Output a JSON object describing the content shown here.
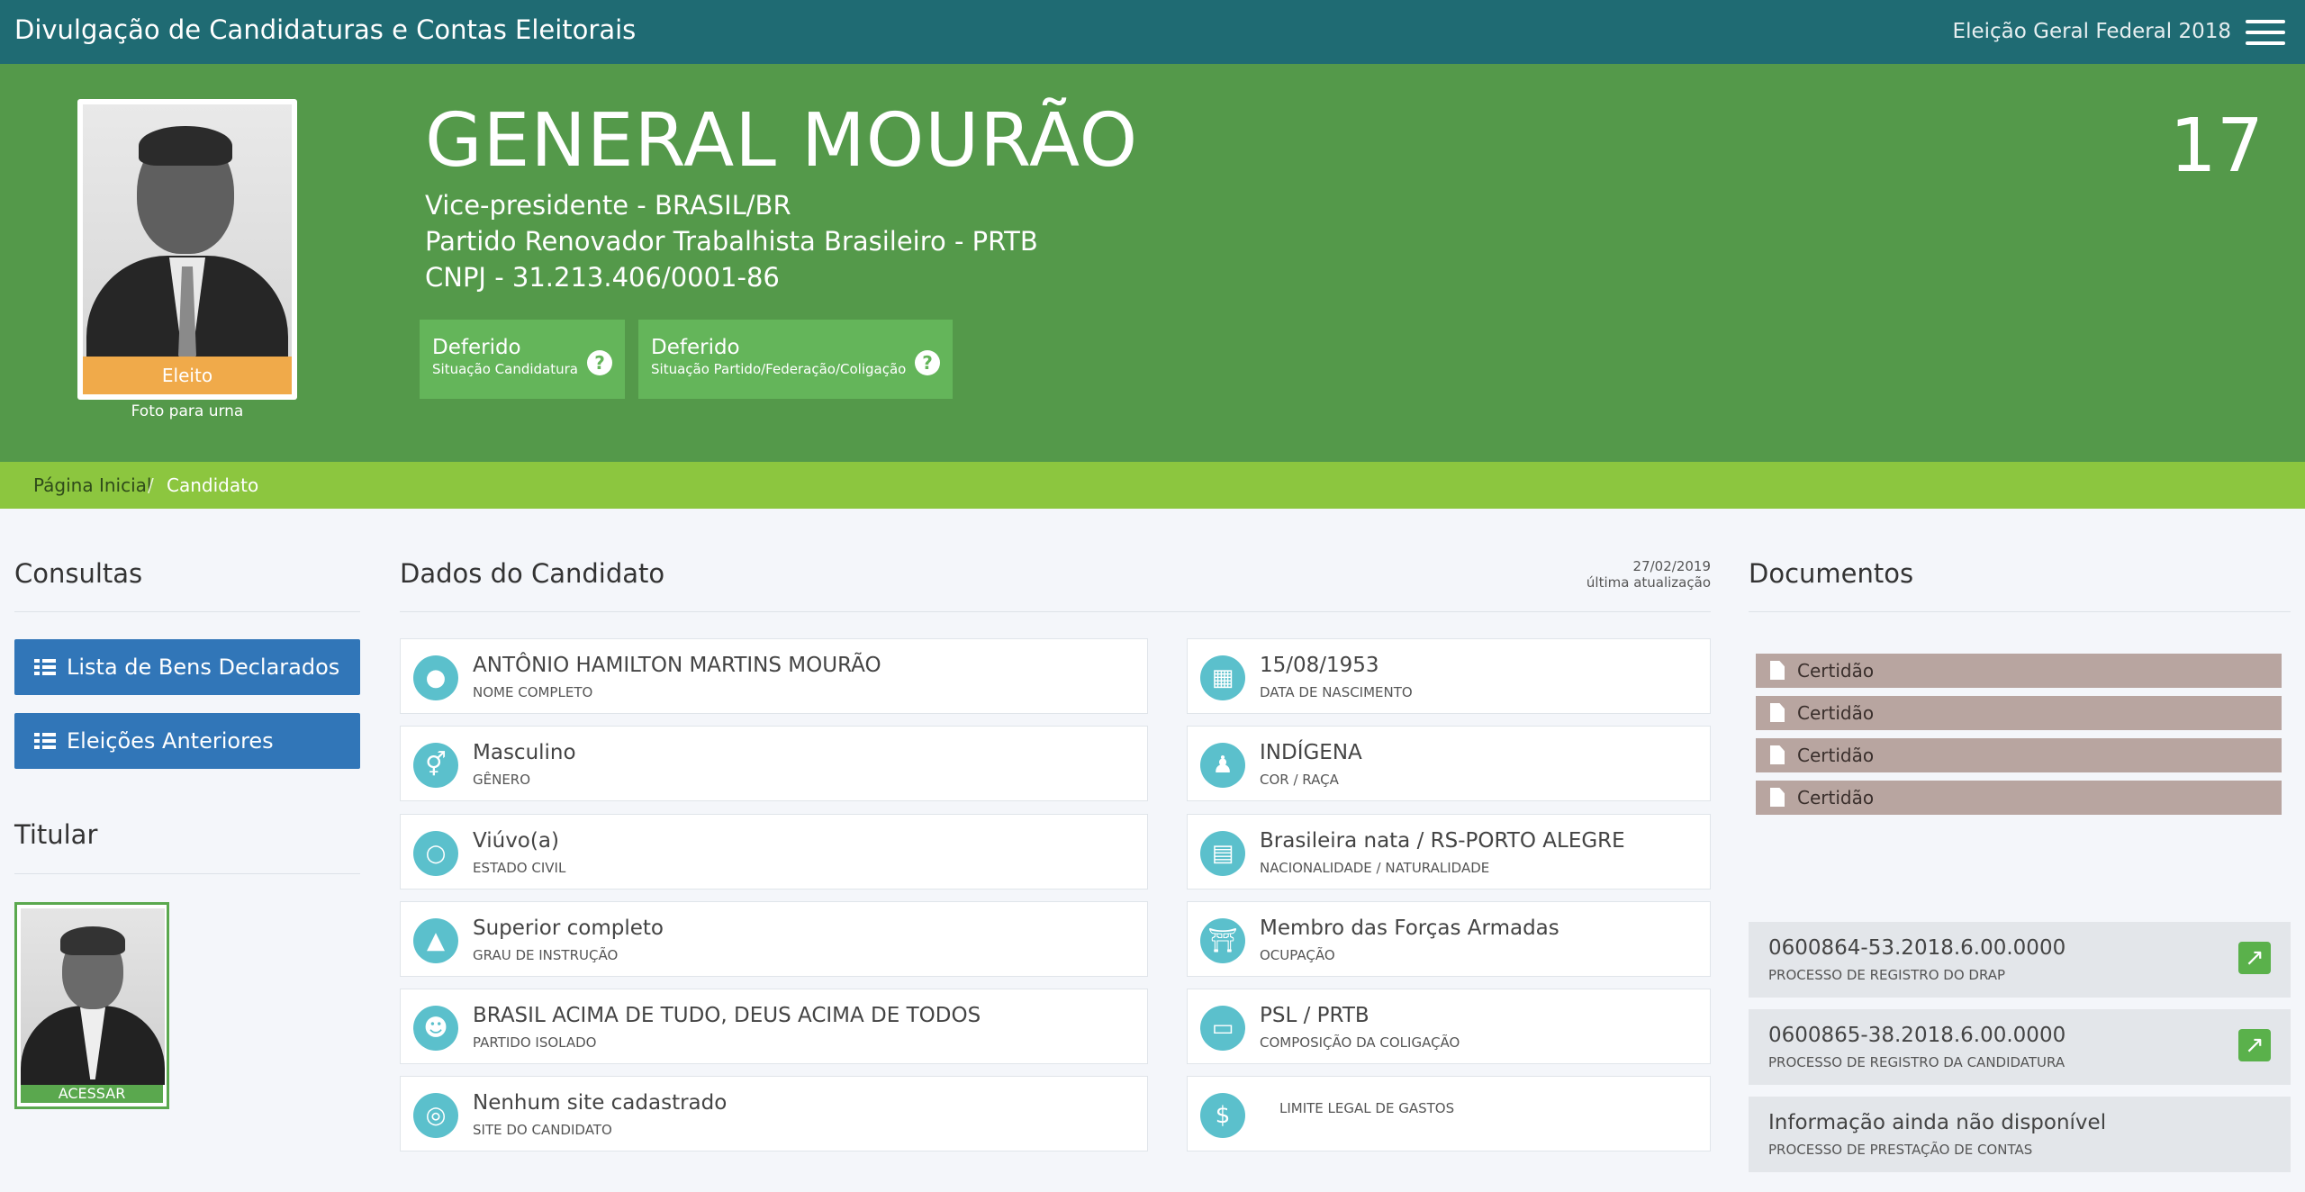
{
  "header": {
    "title": "Divulgação de Candidaturas e Contas Eleitorais",
    "election": "Eleição Geral Federal 2018"
  },
  "candidate": {
    "name": "GENERAL MOURÃO",
    "number": "17",
    "office": "Vice-presidente - BRASIL/BR",
    "party": "Partido Renovador Trabalhista Brasileiro - PRTB",
    "cnpj": "CNPJ - 31.213.406/0001-86",
    "photo_badge": "Eleito",
    "photo_caption": "Foto para urna",
    "status": [
      {
        "value": "Deferido",
        "label": "Situação Candidatura"
      },
      {
        "value": "Deferido",
        "label": "Situação Partido/Federação/Coligação"
      }
    ]
  },
  "breadcrumb": {
    "home": "Página Inicial",
    "separator": "/",
    "current": "Candidato"
  },
  "consultas": {
    "title": "Consultas",
    "buttons": [
      "Lista de Bens Declarados",
      "Eleições Anteriores"
    ]
  },
  "titular": {
    "title": "Titular",
    "access": "ACESSAR"
  },
  "dados": {
    "title": "Dados do Candidato",
    "updated_date": "27/02/2019",
    "updated_label": "última atualização",
    "left": [
      {
        "icon": "user-icon",
        "value": "ANTÔNIO HAMILTON MARTINS MOURÃO",
        "label": "NOME COMPLETO"
      },
      {
        "icon": "gender-icon",
        "value": "Masculino",
        "label": "GÊNERO"
      },
      {
        "icon": "circle-icon",
        "value": "Viúvo(a)",
        "label": "ESTADO CIVIL"
      },
      {
        "icon": "graduation-cap-icon",
        "value": "Superior completo",
        "label": "GRAU DE INSTRUÇÃO"
      },
      {
        "icon": "users-icon",
        "value": "BRASIL ACIMA DE TUDO, DEUS ACIMA DE TODOS",
        "label": "PARTIDO ISOLADO"
      },
      {
        "icon": "globe-icon",
        "value": "Nenhum site cadastrado",
        "label": "SITE DO CANDIDATO"
      }
    ],
    "right": [
      {
        "icon": "calendar-icon",
        "value": "15/08/1953",
        "label": "DATA DE NASCIMENTO"
      },
      {
        "icon": "person-icon",
        "value": "INDÍGENA",
        "label": "COR / RAÇA"
      },
      {
        "icon": "map-icon",
        "value": "Brasileira nata / RS-PORTO ALEGRE",
        "label": "NACIONALIDADE / NATURALIDADE"
      },
      {
        "icon": "institution-icon",
        "value": "Membro das Forças Armadas",
        "label": "OCUPAÇÃO"
      },
      {
        "icon": "folder-open-icon",
        "value": "PSL / PRTB",
        "label": "COMPOSIÇÃO DA COLIGAÇÃO"
      },
      {
        "icon": "dollar-icon",
        "value": "",
        "label": "LIMITE LEGAL DE GASTOS"
      }
    ]
  },
  "documentos": {
    "title": "Documentos",
    "files": [
      "Certidão",
      "Certidão",
      "Certidão",
      "Certidão"
    ],
    "processes": [
      {
        "value": "0600864-53.2018.6.00.0000",
        "label": "PROCESSO DE REGISTRO DO DRAP",
        "link": true
      },
      {
        "value": "0600865-38.2018.6.00.0000",
        "label": "PROCESSO DE REGISTRO DA CANDIDATURA",
        "link": true
      },
      {
        "value": "Informação ainda não disponível",
        "label": "PROCESSO DE PRESTAÇÃO DE CONTAS",
        "link": false
      }
    ]
  },
  "colors": {
    "topbar": "#1f6b73",
    "hero": "#54994a",
    "breadcrumb": "#8cc63f",
    "primary_button": "#3176b8",
    "elected_badge": "#f0aa4a",
    "icon_circle": "#5bc0cc",
    "document_button": "#b8a5a0"
  }
}
